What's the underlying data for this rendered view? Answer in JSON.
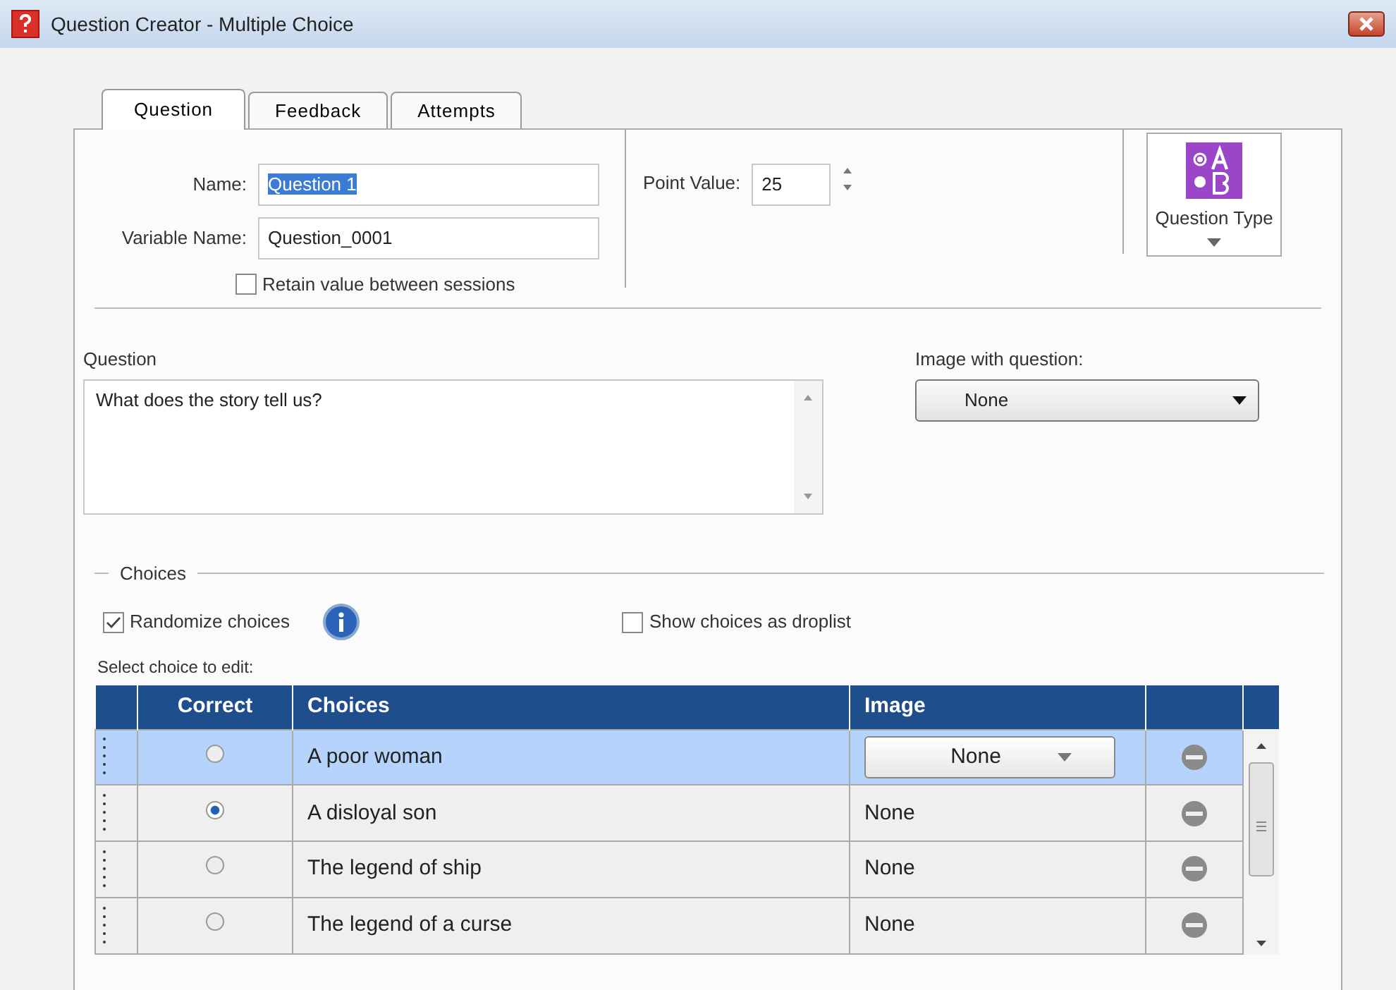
{
  "window": {
    "title": "Question Creator - Multiple Choice"
  },
  "tabs": [
    {
      "label": "Question",
      "selected": true
    },
    {
      "label": "Feedback",
      "selected": false
    },
    {
      "label": "Attempts",
      "selected": false
    }
  ],
  "name": {
    "label": "Name:",
    "value": "Question 1"
  },
  "variable_name": {
    "label": "Variable Name:",
    "value": "Question_0001"
  },
  "retain": {
    "label": "Retain value between sessions",
    "checked": false
  },
  "point_value": {
    "label": "Point Value:",
    "value": "25"
  },
  "question_type": {
    "label": "Question Type"
  },
  "question": {
    "label": "Question",
    "value": "What does the story tell us?"
  },
  "image_with_question": {
    "label": "Image with question:",
    "value": "None"
  },
  "choices_section": {
    "label": "Choices"
  },
  "randomize": {
    "label": "Randomize choices",
    "checked": true
  },
  "show_droplist": {
    "label": "Show choices as droplist",
    "checked": false
  },
  "select_hint": "Select choice to edit:",
  "table": {
    "columns": [
      "Correct",
      "Choices",
      "Image"
    ],
    "rows": [
      {
        "correct": false,
        "choice": "A poor woman",
        "image": "None",
        "selected": true
      },
      {
        "correct": true,
        "choice": "A disloyal son",
        "image": "None",
        "selected": false
      },
      {
        "correct": false,
        "choice": "The legend of ship",
        "image": "None",
        "selected": false
      },
      {
        "correct": false,
        "choice": "The legend of a curse",
        "image": "None",
        "selected": false
      }
    ]
  }
}
